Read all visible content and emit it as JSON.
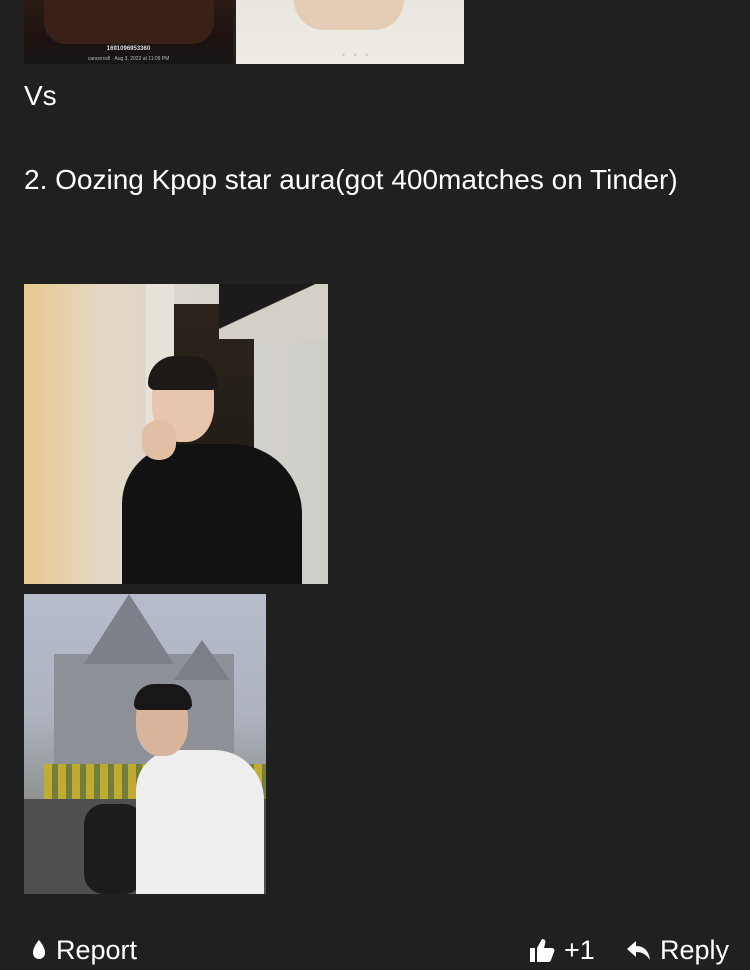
{
  "top_images": {
    "left_caption_id": "1691096953360",
    "left_caption_meta": "cancercell · Aug 3, 2023 at 11:09 PM"
  },
  "post": {
    "vs_text": "Vs",
    "point_text": "2. Oozing Kpop star aura(got 400matches on Tinder)"
  },
  "actions": {
    "report_label": "Report",
    "like_icon": "thumbs-up-icon",
    "like_count": "+1",
    "reply_label": "Reply",
    "report_icon": "flag-icon",
    "reply_icon": "reply-arrow-icon"
  },
  "colors": {
    "background": "#202020",
    "text": "#ffffff"
  }
}
